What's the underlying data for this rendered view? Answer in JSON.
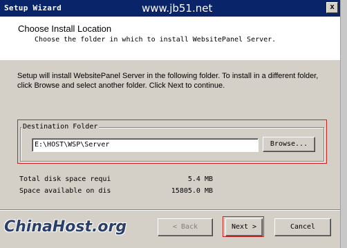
{
  "window": {
    "title": "Setup Wizard",
    "close_glyph": "x",
    "watermark": "www.jb51.net"
  },
  "header": {
    "title": "Choose Install Location",
    "subtitle": "Choose the folder in which to install WebsitePanel Server."
  },
  "intro_text": "Setup will install WebsitePanel Server in the following folder. To install in a different folder, click Browse and select another folder. Click Next to continue.",
  "destination": {
    "group_label": "Destination Folder",
    "path": "E:\\HOST\\WSP\\Server",
    "browse_label": "Browse..."
  },
  "disk": {
    "required_label": "Total disk space requi",
    "required_value": "5.4 MB",
    "available_label": "Space available on dis",
    "available_value": "15805.0 MB"
  },
  "buttons": {
    "back": "< Back",
    "next": "Next >",
    "cancel": "Cancel"
  },
  "brand_watermark": "ChinaHost.org",
  "icons": {
    "close": "close-icon"
  },
  "colors": {
    "titlebar": "#0a246a",
    "highlight_box": "#d02020",
    "dialog_bg": "#d4d0c8"
  }
}
